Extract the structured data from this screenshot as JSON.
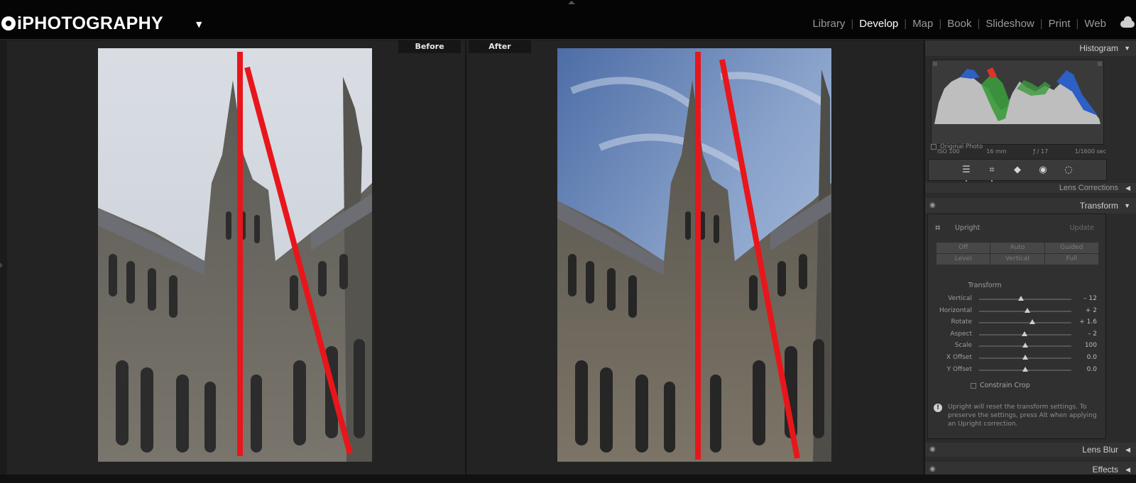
{
  "brand": {
    "logo_text": "iPHOTOGRAPHY"
  },
  "nav": {
    "modules": [
      "Library",
      "Develop",
      "Map",
      "Book",
      "Slideshow",
      "Print",
      "Web"
    ],
    "active": "Develop"
  },
  "view": {
    "before_label": "Before",
    "after_label": "After"
  },
  "panel": {
    "histogram": {
      "title": "Histogram",
      "iso": "ISO 100",
      "focal": "16 mm",
      "aperture": "ƒ / 17",
      "shutter": "1/1600 sec",
      "original_photo": "Original Photo"
    },
    "lens_corrections": "Lens Corrections",
    "transform": {
      "title": "Transform",
      "upright_label": "Upright",
      "update_label": "Update",
      "upright_buttons": [
        "Off",
        "Auto",
        "Guided",
        "Level",
        "Vertical",
        "Full"
      ],
      "section_title": "Transform",
      "sliders": [
        {
          "label": "Vertical",
          "value": "– 12",
          "position": 0.45
        },
        {
          "label": "Horizontal",
          "value": "+ 2",
          "position": 0.52
        },
        {
          "label": "Rotate",
          "value": "+ 1.6",
          "position": 0.58
        },
        {
          "label": "Aspect",
          "value": "– 2",
          "position": 0.49
        },
        {
          "label": "Scale",
          "value": "100",
          "position": 0.5
        },
        {
          "label": "X Offset",
          "value": "0.0",
          "position": 0.5
        },
        {
          "label": "Y Offset",
          "value": "0.0",
          "position": 0.5
        }
      ],
      "constrain_crop": "Constrain Crop",
      "note": "Upright will reset the transform settings. To preserve the settings, press Alt when applying an Upright correction."
    },
    "lens_blur": "Lens Blur",
    "effects": "Effects"
  },
  "colors": {
    "guide_line": "#e8161b",
    "accent_red": "#e0322a",
    "accent_green": "#3c9a3c",
    "accent_blue": "#2d5fc4"
  }
}
